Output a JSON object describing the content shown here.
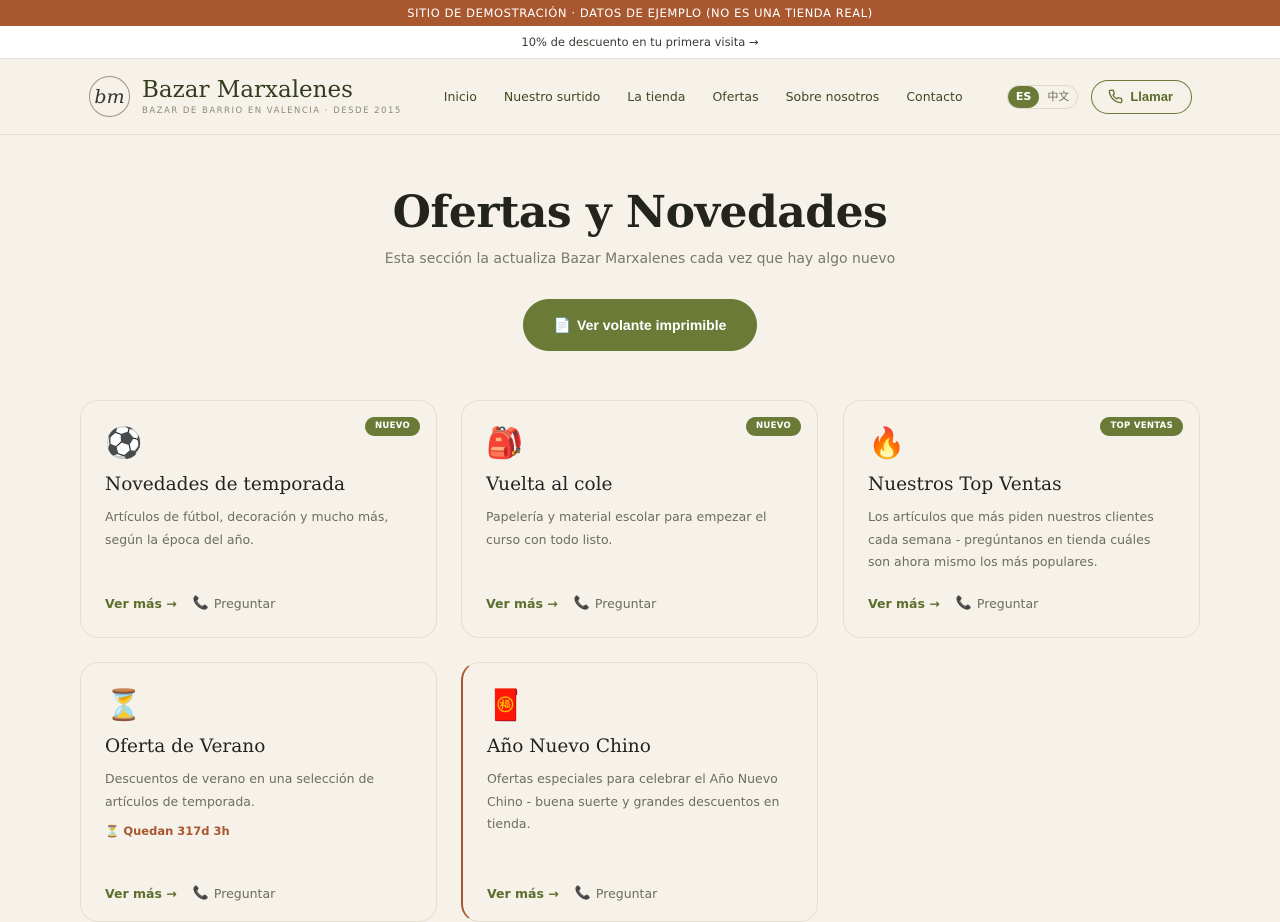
{
  "top_banner": "SITIO DE DEMOSTRACIÓN · DATOS DE EJEMPLO (NO ES UNA TIENDA REAL)",
  "promo": "10% de descuento en tu primera visita →",
  "header": {
    "logo_mark": "bm",
    "name": "Bazar Marxalenes",
    "tagline": "BAZAR DE BARRIO EN VALENCIA · DESDE 2015",
    "nav": [
      "Inicio",
      "Nuestro surtido",
      "La tienda",
      "Ofertas",
      "Sobre nosotros",
      "Contacto"
    ],
    "lang": {
      "active": "ES",
      "other": "中文"
    },
    "call_label": "Llamar"
  },
  "hero": {
    "title": "Ofertas y Novedades",
    "subtitle": "Esta sección la actualiza Bazar Marxalenes cada vez que hay algo nuevo",
    "flyer_icon": "📄",
    "flyer_label": "Ver volante imprimible"
  },
  "cards": [
    {
      "icon": "⚽",
      "badge": "NUEVO",
      "title": "Novedades de temporada",
      "desc": "Artículos de fútbol, decoración y mucho más, según la época del año.",
      "more": "Ver más →",
      "ask_icon": "📞",
      "ask": "Preguntar"
    },
    {
      "icon": "🎒",
      "badge": "NUEVO",
      "title": "Vuelta al cole",
      "desc": "Papelería y material escolar para empezar el curso con todo listo.",
      "more": "Ver más →",
      "ask_icon": "📞",
      "ask": "Preguntar"
    },
    {
      "icon": "🔥",
      "badge": "TOP VENTAS",
      "title": "Nuestros Top Ventas",
      "desc": "Los artículos que más piden nuestros clientes cada semana - pregúntanos en tienda cuáles son ahora mismo los más populares.",
      "more": "Ver más →",
      "ask_icon": "📞",
      "ask": "Preguntar"
    },
    {
      "icon": "⏳",
      "badge": "",
      "title": "Oferta de Verano",
      "desc": "Descuentos de verano en una selección de artículos de temporada.",
      "countdown": "⏳ Quedan 317d 3h",
      "more": "Ver más →",
      "ask_icon": "📞",
      "ask": "Preguntar"
    },
    {
      "icon": "🧧",
      "badge": "",
      "title": "Año Nuevo Chino",
      "desc": "Ofertas especiales para celebrar el Año Nuevo Chino - buena suerte y grandes descuentos en tienda.",
      "more": "Ver más →",
      "ask_icon": "📞",
      "ask": "Preguntar"
    }
  ],
  "colors": {
    "accent": "#6b7a36",
    "banner": "#a9572e",
    "background": "#f6f2ea"
  }
}
